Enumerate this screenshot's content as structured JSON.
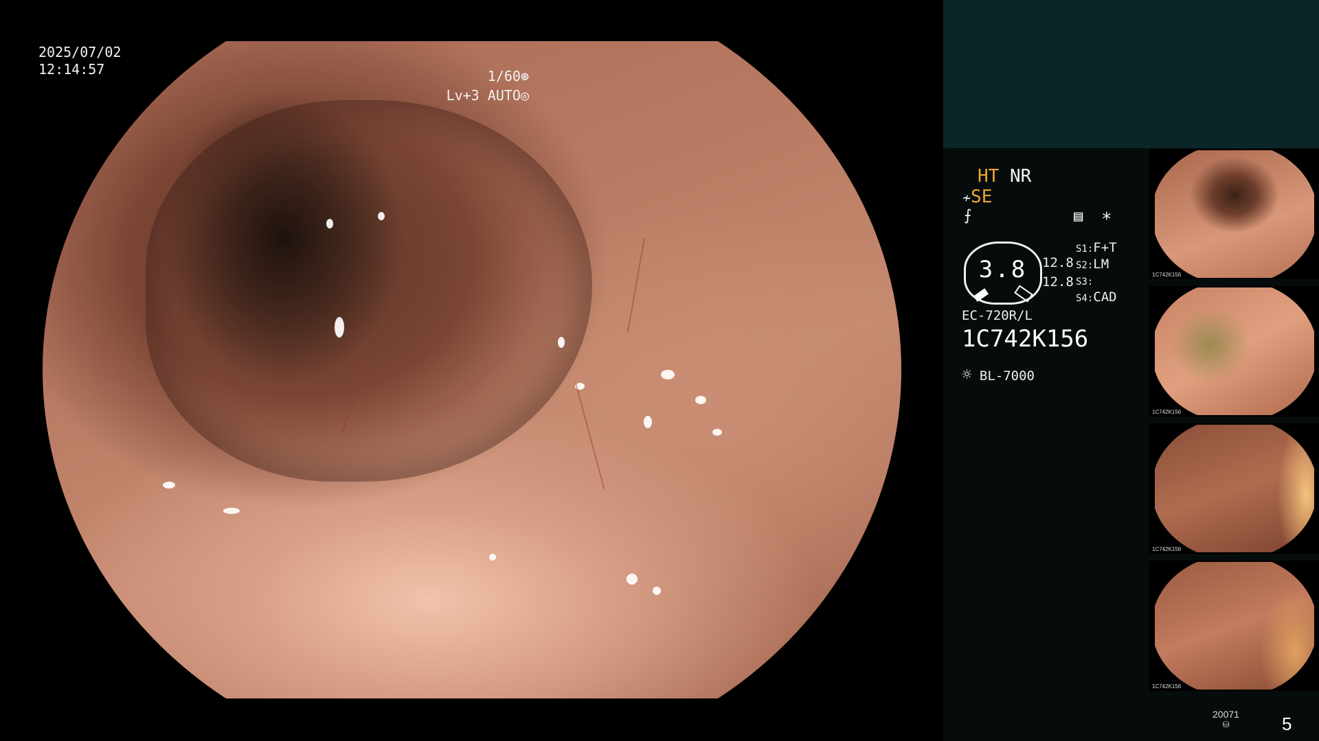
{
  "osd": {
    "date": "2025/07/02",
    "time": "12:14:57",
    "shutter": "1/60",
    "level": "Lv+3",
    "mode": "AUTO"
  },
  "panel": {
    "ht": "HT",
    "nr": "NR",
    "se": "SE",
    "meter_value": "3.8",
    "meter_top": "12.8",
    "meter_bottom": "12.8",
    "s1_key": "S1:",
    "s1_val": "F+T",
    "s2_key": "S2:",
    "s2_val": "LM",
    "s3_key": "S3:",
    "s3_val": "",
    "s4_key": "S4:",
    "s4_val": "CAD",
    "scope_model": "EC-720R/L",
    "serial": "1C742K156",
    "light_source": "BL-7000",
    "asterisk": "*",
    "counter": "20071",
    "page_number": "5"
  },
  "thumbnails": [
    {
      "label": "1C742K156"
    },
    {
      "label": "1C742K156"
    },
    {
      "label": "1C742K156"
    },
    {
      "label": "1C742K156"
    }
  ],
  "colors": {
    "panel_bg": "#060c0c",
    "panel_header": "#0b2626",
    "accent_orange": "#f2a533"
  }
}
